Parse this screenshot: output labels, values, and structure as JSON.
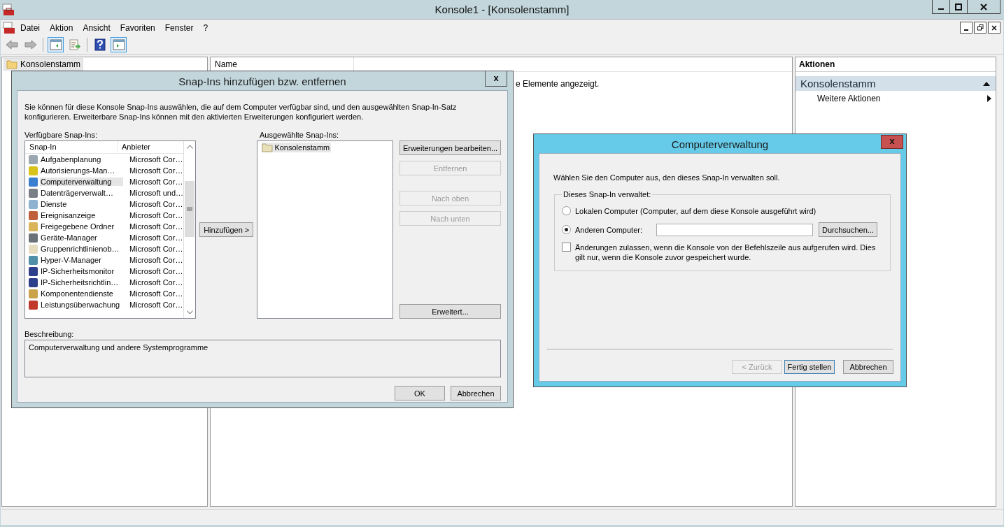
{
  "window": {
    "title": "Konsole1 - [Konsolenstamm]"
  },
  "menu": [
    "Datei",
    "Aktion",
    "Ansicht",
    "Favoriten",
    "Fenster",
    "?"
  ],
  "toolbar": [
    {
      "kind": "back",
      "disabled": true
    },
    {
      "kind": "forward",
      "disabled": true
    },
    {
      "kind": "tree-pane",
      "on": true
    },
    {
      "kind": "export",
      "on": false
    },
    {
      "kind": "help",
      "on": false
    },
    {
      "kind": "action-pane",
      "on": true
    }
  ],
  "tree": {
    "items": [
      {
        "label": "Konsolenstamm",
        "selected": true
      }
    ]
  },
  "center": {
    "columns": [
      "Name"
    ],
    "empty_text": "e Elemente angezeigt."
  },
  "actions": {
    "title": "Aktionen",
    "section": "Konsolenstamm",
    "expanded": true,
    "items": [
      {
        "label": "Weitere Aktionen"
      }
    ]
  },
  "snapin_dialog": {
    "title": "Snap-Ins hinzufügen bzw. entfernen",
    "close": "x",
    "intro": "Sie können für diese Konsole Snap-Ins auswählen, die auf dem Computer verfügbar sind, und den ausgewählten Snap-In-Satz konfigurieren. Erweiterbare Snap-Ins können mit den aktivierten Erweiterungen konfiguriert werden.",
    "available_label": "Verfügbare Snap-Ins:",
    "columns": [
      "Snap-In",
      "Anbieter"
    ],
    "rows": [
      {
        "name": "Aufgabenplanung",
        "vendor": "Microsoft Cor…",
        "selected": false,
        "color": "#9aa7b0"
      },
      {
        "name": "Autorisierungs-Man…",
        "vendor": "Microsoft Cor…",
        "selected": false,
        "color": "#d8c21c"
      },
      {
        "name": "Computerverwaltung",
        "vendor": "Microsoft Cor…",
        "selected": true,
        "color": "#3a7fd0"
      },
      {
        "name": "Datenträgerverwalt…",
        "vendor": "Microsoft und…",
        "selected": false,
        "color": "#7a7f86"
      },
      {
        "name": "Dienste",
        "vendor": "Microsoft Cor…",
        "selected": false,
        "color": "#8fb2d0"
      },
      {
        "name": "Ereignisanzeige",
        "vendor": "Microsoft Cor…",
        "selected": false,
        "color": "#c0603a"
      },
      {
        "name": "Freigegebene Ordner",
        "vendor": "Microsoft Cor…",
        "selected": false,
        "color": "#d9b458"
      },
      {
        "name": "Geräte-Manager",
        "vendor": "Microsoft Cor…",
        "selected": false,
        "color": "#6c7279"
      },
      {
        "name": "Gruppenrichtlinienob…",
        "vendor": "Microsoft Cor…",
        "selected": false,
        "color": "#e6dcc0"
      },
      {
        "name": "Hyper-V-Manager",
        "vendor": "Microsoft Cor…",
        "selected": false,
        "color": "#4f8fa8"
      },
      {
        "name": "IP-Sicherheitsmonitor",
        "vendor": "Microsoft Cor…",
        "selected": false,
        "color": "#2d3f8a"
      },
      {
        "name": "IP-Sicherheitsrichtlin…",
        "vendor": "Microsoft Cor…",
        "selected": false,
        "color": "#2d3f8a"
      },
      {
        "name": "Komponentendienste",
        "vendor": "Microsoft Cor…",
        "selected": false,
        "color": "#c9a24a"
      },
      {
        "name": "Leistungsüberwachung",
        "vendor": "Microsoft Cor…",
        "selected": false,
        "color": "#c0392b"
      }
    ],
    "add_button": "Hinzufügen >",
    "selected_label": "Ausgewählte Snap-Ins:",
    "selected_items": [
      {
        "label": "Konsolenstamm",
        "selected": true
      }
    ],
    "side_buttons": [
      {
        "label": "Erweiterungen bearbeiten...",
        "disabled": false
      },
      {
        "label": "Entfernen",
        "disabled": true
      },
      {
        "label": "Nach oben",
        "disabled": true
      },
      {
        "label": "Nach unten",
        "disabled": true
      }
    ],
    "advanced_button": "Erweitert...",
    "description_label": "Beschreibung:",
    "description": "Computerverwaltung und andere Systemprogramme",
    "buttons": [
      {
        "label": "OK"
      },
      {
        "label": "Abbrechen"
      }
    ]
  },
  "computer_dialog": {
    "title": "Computerverwaltung",
    "close": "x",
    "prompt": "Wählen Sie den Computer aus, den dieses Snap-In verwalten soll.",
    "group_label": "Dieses Snap-In verwaltet:",
    "options": [
      {
        "label": "Lokalen Computer (Computer, auf dem diese Konsole ausgeführt wird)",
        "selected": false
      },
      {
        "label": "Anderen Computer:",
        "selected": true
      }
    ],
    "browse_button": "Durchsuchen...",
    "allow_changes": {
      "label": "Änderungen zulassen, wenn die Konsole von der Befehlszeile aus aufgerufen wird. Dies gilt nur, wenn die Konsole zuvor gespeichert wurde.",
      "checked": false
    },
    "buttons": [
      {
        "label": "< Zurück",
        "disabled": true,
        "default": false
      },
      {
        "label": "Fertig stellen",
        "disabled": false,
        "default": true
      },
      {
        "label": "Abbrechen",
        "disabled": false,
        "default": false
      }
    ]
  }
}
